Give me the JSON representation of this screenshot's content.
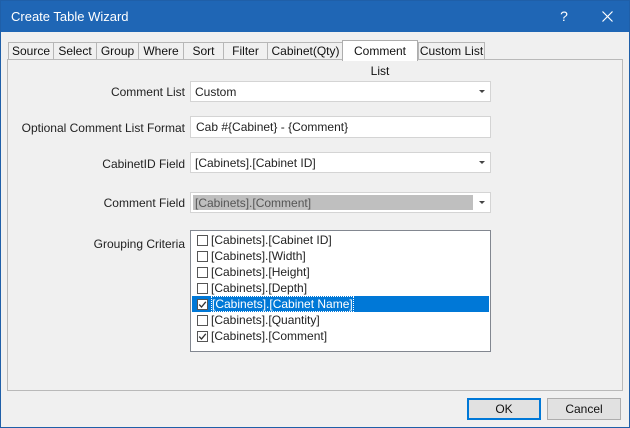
{
  "window": {
    "title": "Create Table Wizard",
    "help_label": "?",
    "close_icon": "close-icon",
    "accent": "#1f66b5"
  },
  "tabs": [
    {
      "label": "Source",
      "active": false
    },
    {
      "label": "Select",
      "active": false
    },
    {
      "label": "Group",
      "active": false
    },
    {
      "label": "Where",
      "active": false
    },
    {
      "label": "Sort",
      "active": false
    },
    {
      "label": "Filter",
      "active": false
    },
    {
      "label": "Cabinet(Qty)",
      "active": false
    },
    {
      "label": "Comment List",
      "active": true
    },
    {
      "label": "Custom List",
      "active": false
    }
  ],
  "form": {
    "comment_list": {
      "label": "Comment List",
      "value": "Custom"
    },
    "format": {
      "label": "Optional Comment List Format",
      "value": "Cab #{Cabinet} - {Comment}"
    },
    "cabinet_id_field": {
      "label": "CabinetID Field",
      "value": "[Cabinets].[Cabinet ID]"
    },
    "comment_field": {
      "label": "Comment Field",
      "value": "[Cabinets].[Comment]",
      "disabled": true
    },
    "grouping": {
      "label": "Grouping Criteria",
      "items": [
        {
          "label": "[Cabinets].[Cabinet ID]",
          "checked": false,
          "selected": false
        },
        {
          "label": "[Cabinets].[Width]",
          "checked": false,
          "selected": false
        },
        {
          "label": "[Cabinets].[Height]",
          "checked": false,
          "selected": false
        },
        {
          "label": "[Cabinets].[Depth]",
          "checked": false,
          "selected": false
        },
        {
          "label": "[Cabinets].[Cabinet Name]",
          "checked": true,
          "selected": true
        },
        {
          "label": "[Cabinets].[Quantity]",
          "checked": false,
          "selected": false
        },
        {
          "label": "[Cabinets].[Comment]",
          "checked": true,
          "selected": false
        }
      ],
      "selection_color": "#0078d7"
    }
  },
  "buttons": {
    "ok": "OK",
    "cancel": "Cancel"
  }
}
